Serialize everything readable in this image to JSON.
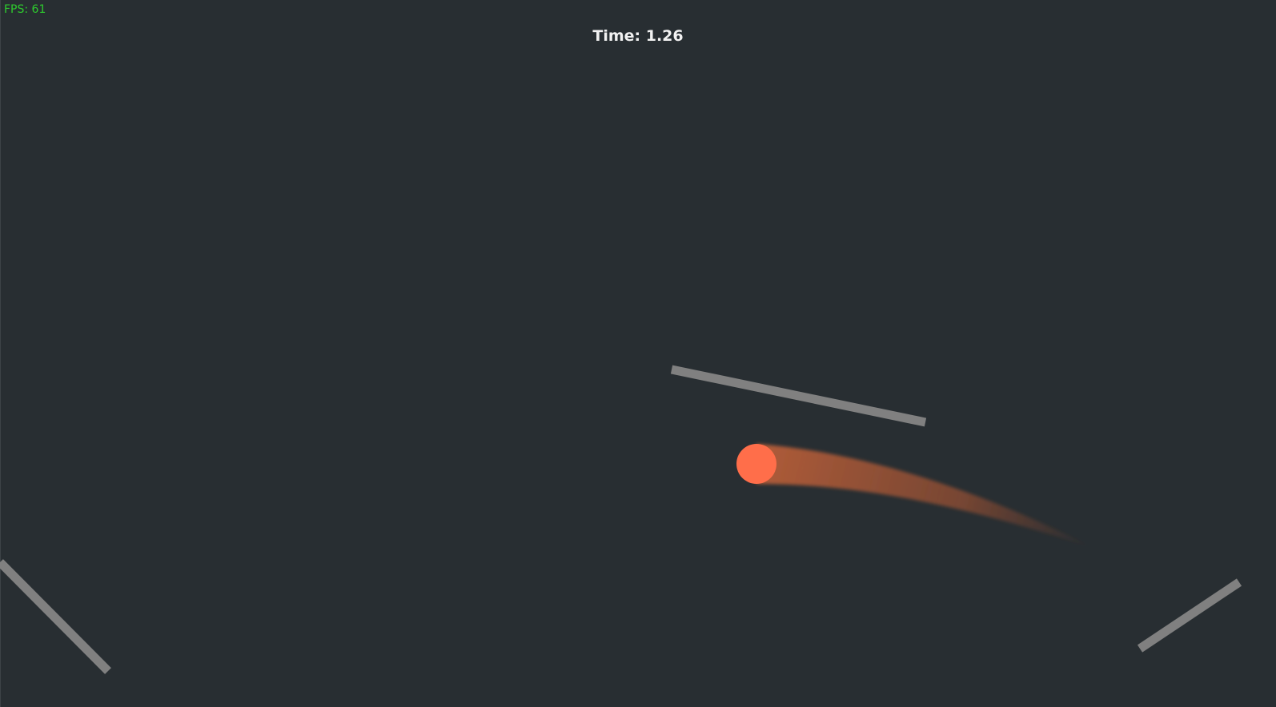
{
  "hud": {
    "fps_text": "FPS: 61",
    "time_text": "Time: 1.26",
    "fps_color": "#2ecc2e",
    "time_color": "#f2f2f2"
  },
  "scene": {
    "background_color": "#282e32",
    "platform_color": "#808080",
    "ball_color": "#ff6e4a",
    "trail_color": "#c8643a"
  }
}
